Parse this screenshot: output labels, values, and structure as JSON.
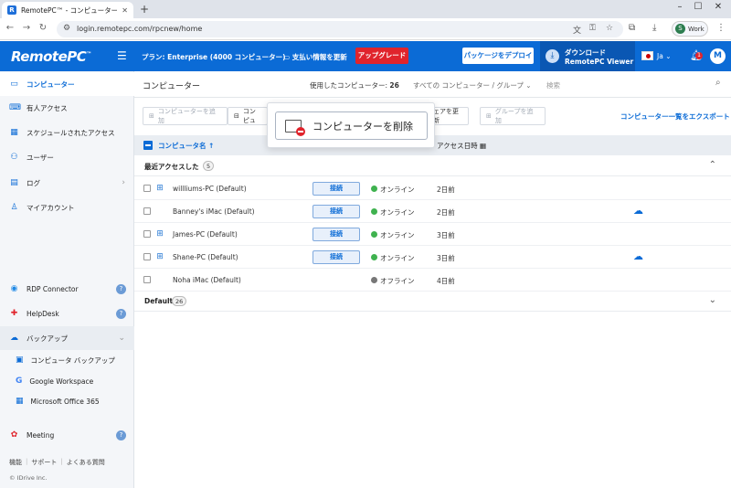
{
  "browser": {
    "tab_title": "RemotePC™ - コンピューター",
    "url": "login.remotepc.com/rpcnew/home",
    "profile_initial": "S",
    "profile_label": "Work"
  },
  "header": {
    "logo": "RemotePC",
    "logo_mark": "™",
    "plan": "プラン: Enterprise (4000 コンピューター)",
    "payment": "支払い情報を更新",
    "upgrade": "アップグレード",
    "deploy": "パッケージをデプロイ",
    "download_line1": "ダウンロード",
    "download_line2": "RemotePC Viewer",
    "language": "Ja",
    "notification_count": "1",
    "avatar_initial": "M"
  },
  "sidebar": {
    "items": [
      {
        "label": "コンピューター",
        "icon": "monitor-icon"
      },
      {
        "label": "有人アクセス",
        "icon": "keyboard-icon"
      },
      {
        "label": "スケジュールされたアクセス",
        "icon": "calendar-icon"
      },
      {
        "label": "ユーザー",
        "icon": "users-icon"
      },
      {
        "label": "ログ",
        "icon": "log-icon"
      },
      {
        "label": "マイアカウント",
        "icon": "user-icon"
      }
    ],
    "tools": [
      {
        "label": "RDP Connector",
        "icon": "rdp-icon"
      },
      {
        "label": "HelpDesk",
        "icon": "helpdesk-icon"
      },
      {
        "label": "バックアップ",
        "icon": "cloud-icon"
      }
    ],
    "backup_sub": [
      {
        "label": "コンピュータ バックアップ"
      },
      {
        "label": "Google Workspace"
      },
      {
        "label": "Microsoft Office 365"
      }
    ],
    "meeting": "Meeting",
    "footer_links": [
      "機能",
      "サポート",
      "よくある質問"
    ],
    "copyright": "© IDrive Inc."
  },
  "main": {
    "title": "コンピューター",
    "used_label": "使用したコンピューター:",
    "used_count": "26",
    "filter": "すべての コンピューター / グループ",
    "search_placeholder": "検索",
    "actions": {
      "add_computer": "コンピューターを追加",
      "second_partial": "コンピュ",
      "third_partial": "ェアを更新",
      "add_group": "グループを追加"
    },
    "export": "コンピューター一覧をエクスポート",
    "columns": {
      "name": "コンピュータ名 ↑",
      "last_access": "アクセス日時"
    },
    "groups": [
      {
        "name": "最近アクセスした",
        "count": "5",
        "rows": [
          {
            "os": "windows",
            "name": "willliums-PC (Default)",
            "connect": "接続",
            "status": "オンライン",
            "status_color": "#3fb24f",
            "last": "2日前",
            "cloud": false
          },
          {
            "os": "mac",
            "name": "Banney's iMac (Default)",
            "connect": "接続",
            "status": "オンライン",
            "status_color": "#3fb24f",
            "last": "2日前",
            "cloud": true
          },
          {
            "os": "windows",
            "name": "James-PC (Default)",
            "connect": "接続",
            "status": "オンライン",
            "status_color": "#3fb24f",
            "last": "3日前",
            "cloud": false
          },
          {
            "os": "windows",
            "name": "Shane-PC (Default)",
            "connect": "接続",
            "status": "オンライン",
            "status_color": "#3fb24f",
            "last": "3日前",
            "cloud": true
          },
          {
            "os": "mac",
            "name": "Noha iMac (Default)",
            "connect": "",
            "status": "オフライン",
            "status_color": "#777777",
            "last": "4日前",
            "cloud": false
          }
        ]
      },
      {
        "name": "Default",
        "count": "26",
        "rows": []
      }
    ]
  },
  "popup": {
    "label": "コンピューターを削除"
  },
  "colors": {
    "accent": "#0b6bd6",
    "upgrade": "#e0242c",
    "online": "#3fb24f"
  }
}
